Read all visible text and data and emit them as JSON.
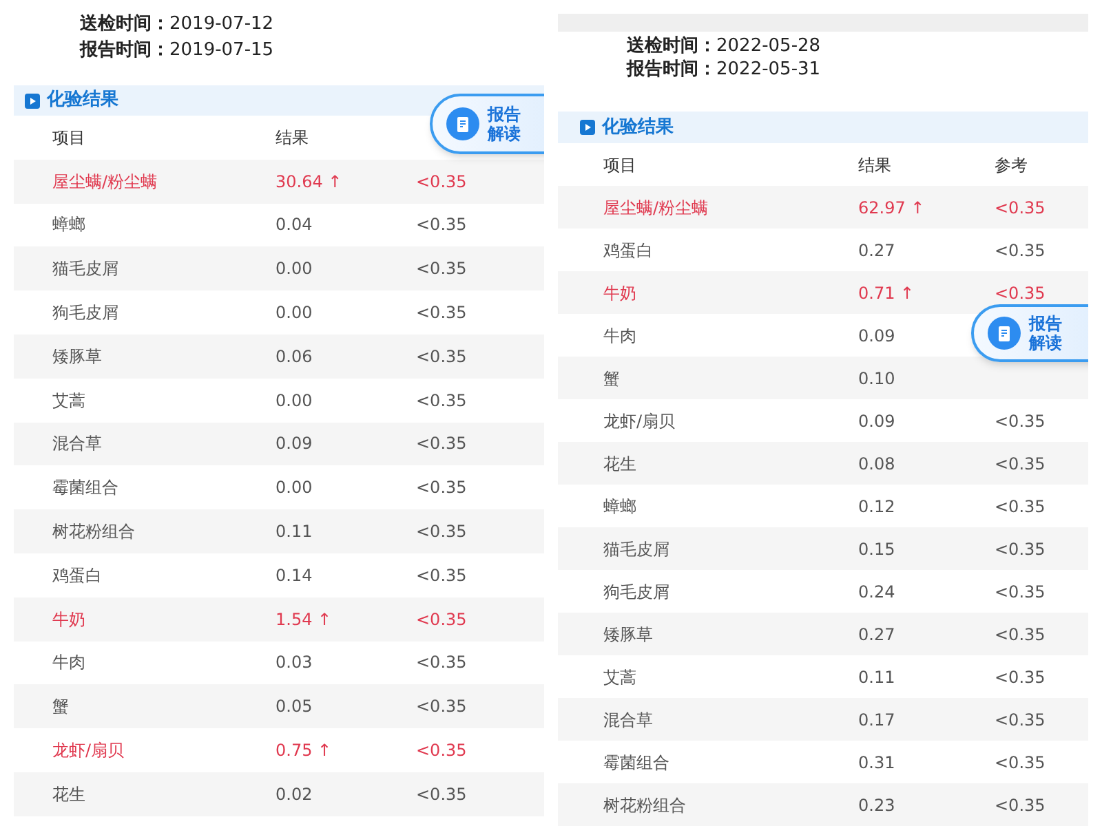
{
  "panels": [
    {
      "dates": [
        {
          "label": "送检时间：",
          "value": "2019-07-12"
        },
        {
          "label": "报告时间：",
          "value": "2019-07-15"
        }
      ],
      "section_title": "化验结果",
      "columns": [
        "项目",
        "结果"
      ],
      "rows": [
        {
          "item": "屋尘螨/粉尘螨",
          "result": "30.64 ↑",
          "reference": "<0.35",
          "flagged": true
        },
        {
          "item": "蟑螂",
          "result": "0.04",
          "reference": "<0.35",
          "flagged": false
        },
        {
          "item": "猫毛皮屑",
          "result": "0.00",
          "reference": "<0.35",
          "flagged": false
        },
        {
          "item": "狗毛皮屑",
          "result": "0.00",
          "reference": "<0.35",
          "flagged": false
        },
        {
          "item": "矮豚草",
          "result": "0.06",
          "reference": "<0.35",
          "flagged": false
        },
        {
          "item": "艾蒿",
          "result": "0.00",
          "reference": "<0.35",
          "flagged": false
        },
        {
          "item": "混合草",
          "result": "0.09",
          "reference": "<0.35",
          "flagged": false
        },
        {
          "item": "霉菌组合",
          "result": "0.00",
          "reference": "<0.35",
          "flagged": false
        },
        {
          "item": "树花粉组合",
          "result": "0.11",
          "reference": "<0.35",
          "flagged": false
        },
        {
          "item": "鸡蛋白",
          "result": "0.14",
          "reference": "<0.35",
          "flagged": false
        },
        {
          "item": "牛奶",
          "result": "1.54 ↑",
          "reference": "<0.35",
          "flagged": true
        },
        {
          "item": "牛肉",
          "result": "0.03",
          "reference": "<0.35",
          "flagged": false
        },
        {
          "item": "蟹",
          "result": "0.05",
          "reference": "<0.35",
          "flagged": false
        },
        {
          "item": "龙虾/扇贝",
          "result": "0.75 ↑",
          "reference": "<0.35",
          "flagged": true
        },
        {
          "item": "花生",
          "result": "0.02",
          "reference": "<0.35",
          "flagged": false
        }
      ],
      "float_button": {
        "label": [
          "报告",
          "解读"
        ]
      }
    },
    {
      "top_bar": true,
      "dates": [
        {
          "label": "送检时间：",
          "value": "2022-05-28"
        },
        {
          "label": "报告时间：",
          "value": "2022-05-31"
        }
      ],
      "section_title": "化验结果",
      "columns": [
        "项目",
        "结果",
        "参考"
      ],
      "rows": [
        {
          "item": "屋尘螨/粉尘螨",
          "result": "62.97 ↑",
          "reference": "<0.35",
          "flagged": true
        },
        {
          "item": "鸡蛋白",
          "result": "0.27",
          "reference": "<0.35",
          "flagged": false
        },
        {
          "item": "牛奶",
          "result": "0.71 ↑",
          "reference": "<0.35",
          "flagged": true
        },
        {
          "item": "牛肉",
          "result": "0.09",
          "flagged": false
        },
        {
          "item": "蟹",
          "result": "0.10",
          "flagged": false
        },
        {
          "item": "龙虾/扇贝",
          "result": "0.09",
          "reference": "<0.35",
          "flagged": false
        },
        {
          "item": "花生",
          "result": "0.08",
          "reference": "<0.35",
          "flagged": false
        },
        {
          "item": "蟑螂",
          "result": "0.12",
          "reference": "<0.35",
          "flagged": false
        },
        {
          "item": "猫毛皮屑",
          "result": "0.15",
          "reference": "<0.35",
          "flagged": false
        },
        {
          "item": "狗毛皮屑",
          "result": "0.24",
          "reference": "<0.35",
          "flagged": false
        },
        {
          "item": "矮豚草",
          "result": "0.27",
          "reference": "<0.35",
          "flagged": false
        },
        {
          "item": "艾蒿",
          "result": "0.11",
          "reference": "<0.35",
          "flagged": false
        },
        {
          "item": "混合草",
          "result": "0.17",
          "reference": "<0.35",
          "flagged": false
        },
        {
          "item": "霉菌组合",
          "result": "0.31",
          "reference": "<0.35",
          "flagged": false
        },
        {
          "item": "树花粉组合",
          "result": "0.23",
          "reference": "<0.35",
          "flagged": false
        }
      ],
      "float_button": {
        "label": [
          "报告",
          "解读"
        ]
      }
    }
  ]
}
